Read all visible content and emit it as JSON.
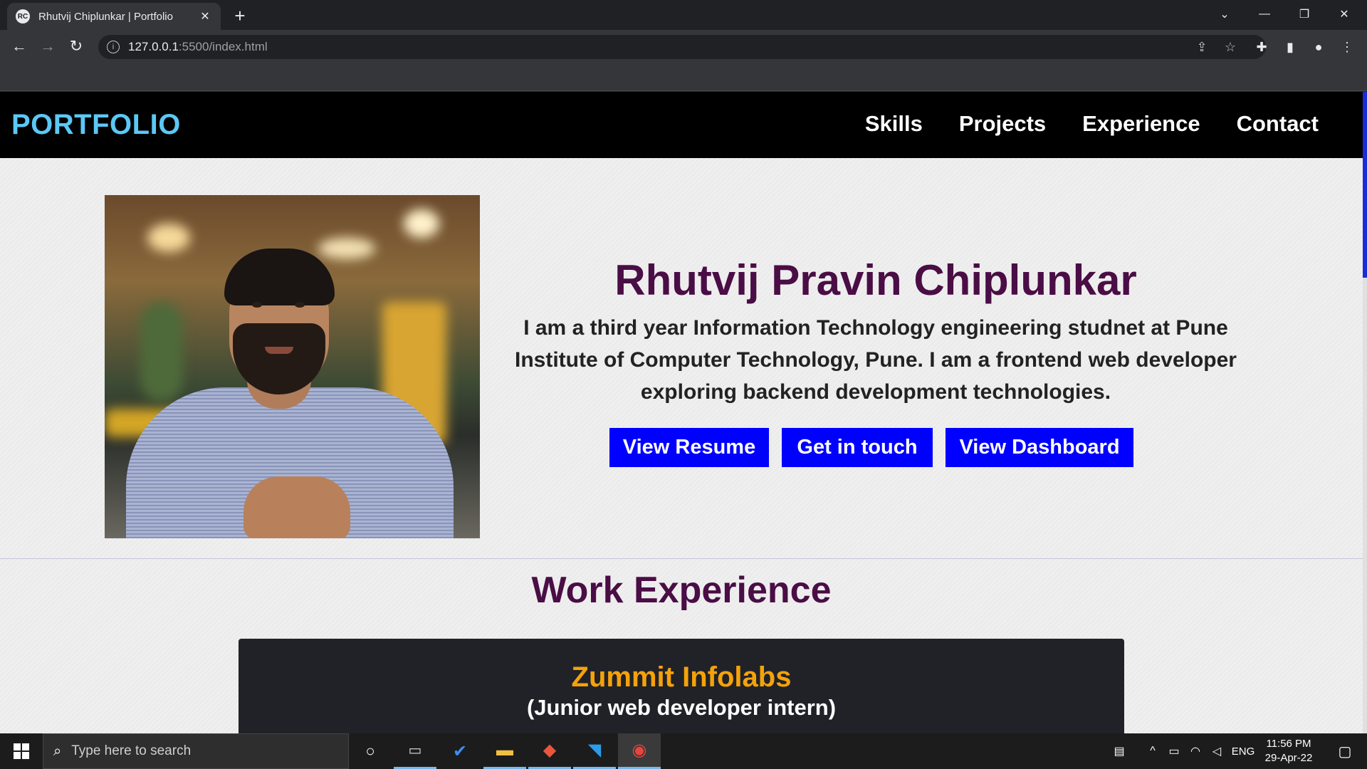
{
  "browser": {
    "tab_title": "Rhutvij Chiplunkar | Portfolio",
    "favicon_text": "RC",
    "tab_close": "✕",
    "new_tab": "+",
    "url_host": "127.0.0.1",
    "url_path": ":5500/index.html",
    "window_controls": [
      "⌄",
      "—",
      "❐",
      "✕"
    ]
  },
  "site": {
    "brand": "PORTFOLIO",
    "nav": [
      "Skills",
      "Projects",
      "Experience",
      "Contact"
    ],
    "hero": {
      "name": "Rhutvij Pravin Chiplunkar",
      "bio_line1": "I am a third year Information Technology engineering studnet at Pune",
      "bio_line2": "Institute of Computer Technology, Pune. I am a frontend web developer",
      "bio_line3": "exploring backend development technologies.",
      "buttons": [
        "View Resume",
        "Get in touch",
        "View Dashboard"
      ]
    },
    "experience": {
      "title": "Work Experience",
      "company": "Zummit Infolabs",
      "role": "(Junior web developer intern)"
    }
  },
  "taskbar": {
    "search_placeholder": "Type here to search",
    "language": "ENG",
    "time": "11:56 PM",
    "date": "29-Apr-22"
  },
  "colors": {
    "brand": "#5bc8f5",
    "heading": "#4a0d45",
    "button": "#0000ff",
    "company": "#f5a20a"
  }
}
